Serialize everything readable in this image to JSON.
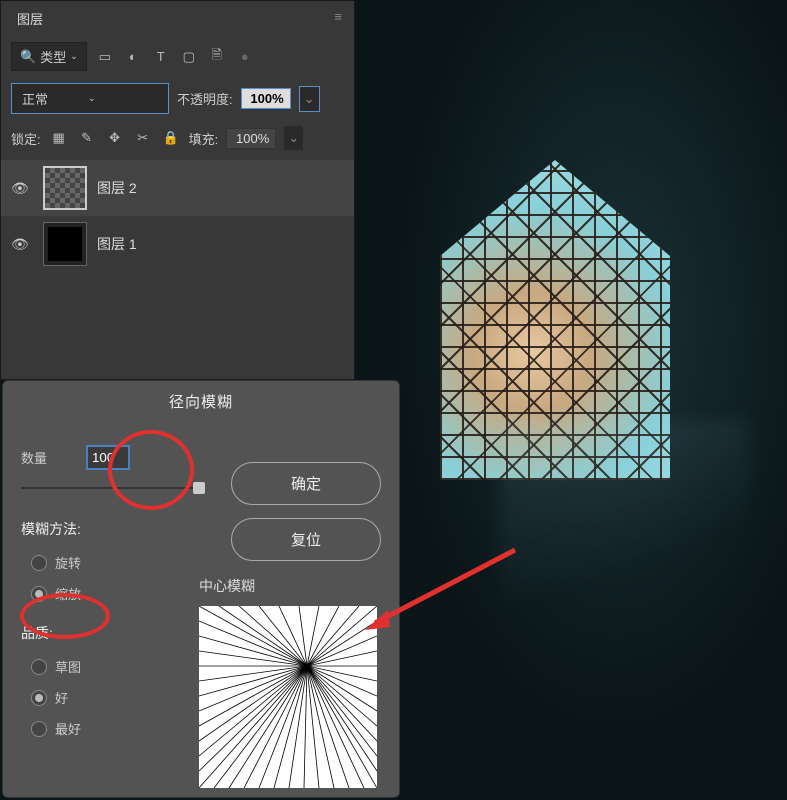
{
  "layers_panel": {
    "tab_label": "图层",
    "filter_label": "类型",
    "blend_mode": "正常",
    "opacity_label": "不透明度:",
    "opacity_value": "100%",
    "lock_label": "锁定:",
    "fill_label": "填充:",
    "fill_value": "100%",
    "layers": [
      {
        "name": "图层 2",
        "selected": true
      },
      {
        "name": "图层 1",
        "selected": false
      }
    ]
  },
  "dialog": {
    "title": "径向模糊",
    "amount_label": "数量",
    "amount_value": "100",
    "ok_label": "确定",
    "reset_label": "复位",
    "method_label": "模糊方法:",
    "method_options": {
      "spin": "旋转",
      "zoom": "缩放"
    },
    "selected_method": "缩放",
    "quality_label": "品质:",
    "quality_options": {
      "draft": "草图",
      "good": "好",
      "best": "最好"
    },
    "selected_quality": "好",
    "center_label": "中心模糊"
  },
  "icons": {
    "search": "🔍",
    "menu": "≡",
    "eye": "👁",
    "image": "▭",
    "adjust": "◐",
    "text": "T",
    "shape": "▢",
    "smart": "🗎",
    "dot": "●",
    "chevron": "⌄",
    "lock_grid": "▦",
    "brush": "✎",
    "move": "✥",
    "crop": "✂",
    "lock": "🔒"
  }
}
